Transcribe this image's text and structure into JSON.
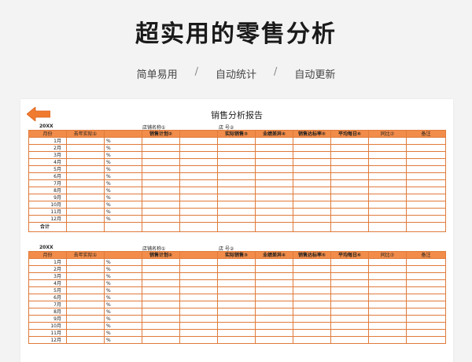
{
  "hero": {
    "title": "超实用的零售分析",
    "features": [
      "简单易用",
      "自动统计",
      "自动更新"
    ],
    "separator": "/"
  },
  "report": {
    "title": "销售分析报告",
    "year": "20XX",
    "store_label": "店铺名称①",
    "no_label": "店  号②",
    "columns": [
      "月份",
      "去年实际①",
      "",
      "销售计划②",
      "",
      "实际销售③",
      "业绩差异④",
      "销售达标率⑤",
      "平均每日⑥",
      "同比⑦",
      "备注"
    ],
    "months": [
      "1月",
      "2月",
      "3月",
      "4月",
      "5月",
      "6月",
      "7月",
      "8月",
      "9月",
      "10月",
      "11月",
      "12月"
    ],
    "percent": "%",
    "total_label": "合计"
  },
  "colors": {
    "header": "#f28c4a",
    "border": "#e07a3a",
    "arrow": "#f07a30"
  }
}
